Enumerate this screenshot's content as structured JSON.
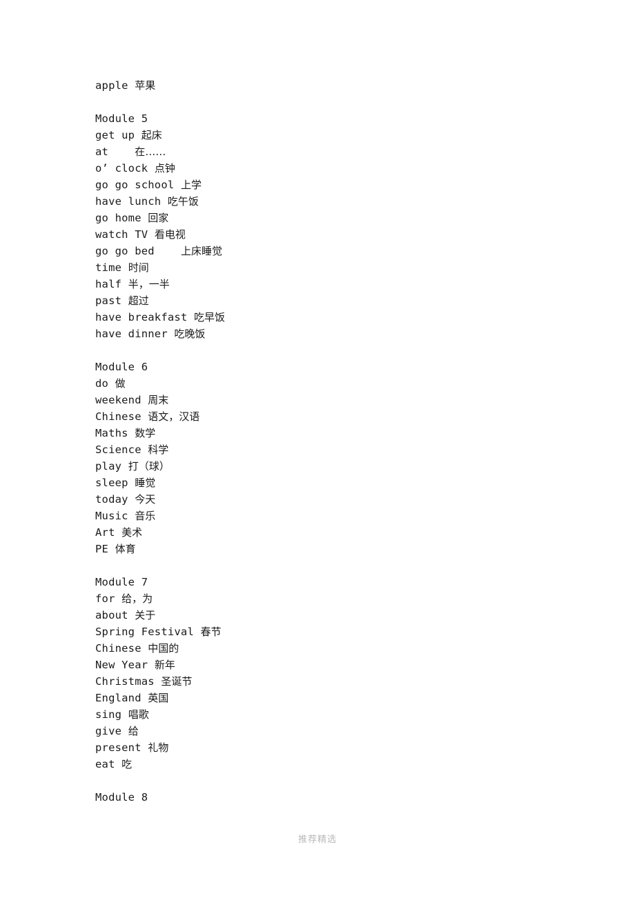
{
  "document": {
    "background_color": "#ffffff",
    "text_color": "#1b1b1b",
    "footer_color": "#b9b9b9",
    "blocks": [
      {
        "id": "block-intro",
        "lines": [
          {
            "en": "apple",
            "cn": "苹果",
            "sep": " "
          }
        ]
      },
      {
        "id": "block-module-5",
        "heading": "Module 5",
        "lines": [
          {
            "en": "get up",
            "cn": "起床",
            "sep": " "
          },
          {
            "en": "at",
            "cn": "在……",
            "sep": "    "
          },
          {
            "en": "o’ clock",
            "cn": "点钟",
            "sep": " "
          },
          {
            "en": "go go school",
            "cn": "上学",
            "sep": " "
          },
          {
            "en": "have lunch",
            "cn": "吃午饭",
            "sep": " "
          },
          {
            "en": "go home",
            "cn": "回家",
            "sep": " "
          },
          {
            "en": "watch TV",
            "cn": "看电视",
            "sep": " "
          },
          {
            "en": "go go bed",
            "cn": "上床睡觉",
            "sep": "    "
          },
          {
            "en": "time",
            "cn": "时间",
            "sep": " "
          },
          {
            "en": "half",
            "cn": "半，一半",
            "sep": " "
          },
          {
            "en": "past",
            "cn": "超过",
            "sep": " "
          },
          {
            "en": "have breakfast",
            "cn": "吃早饭",
            "sep": " "
          },
          {
            "en": "have dinner",
            "cn": "吃晚饭",
            "sep": " "
          }
        ]
      },
      {
        "id": "block-module-6",
        "heading": "Module 6",
        "lines": [
          {
            "en": "do",
            "cn": "做",
            "sep": " "
          },
          {
            "en": "weekend",
            "cn": "周末",
            "sep": " "
          },
          {
            "en": "Chinese",
            "cn": "语文，汉语",
            "sep": " "
          },
          {
            "en": "Maths",
            "cn": "数学",
            "sep": " "
          },
          {
            "en": "Science",
            "cn": "科学",
            "sep": " "
          },
          {
            "en": "play",
            "cn": "打（球）",
            "sep": " "
          },
          {
            "en": "sleep",
            "cn": "睡觉",
            "sep": " "
          },
          {
            "en": "today",
            "cn": "今天",
            "sep": " "
          },
          {
            "en": "Music",
            "cn": "音乐",
            "sep": " "
          },
          {
            "en": "Art",
            "cn": "美术",
            "sep": " "
          },
          {
            "en": "PE",
            "cn": "体育",
            "sep": " "
          }
        ]
      },
      {
        "id": "block-module-7",
        "heading": "Module 7",
        "lines": [
          {
            "en": "for",
            "cn": "给，为",
            "sep": " "
          },
          {
            "en": "about",
            "cn": "关于",
            "sep": " "
          },
          {
            "en": "Spring Festival",
            "cn": "春节",
            "sep": " "
          },
          {
            "en": "Chinese",
            "cn": "中国的",
            "sep": " "
          },
          {
            "en": "New Year",
            "cn": "新年",
            "sep": " "
          },
          {
            "en": "Christmas",
            "cn": "圣诞节",
            "sep": " "
          },
          {
            "en": "England",
            "cn": "英国",
            "sep": " "
          },
          {
            "en": "sing",
            "cn": "唱歌",
            "sep": " "
          },
          {
            "en": "give",
            "cn": "给",
            "sep": " "
          },
          {
            "en": "present",
            "cn": "礼物",
            "sep": " "
          },
          {
            "en": "eat",
            "cn": "吃",
            "sep": " "
          }
        ]
      },
      {
        "id": "block-module-8",
        "heading": "Module 8",
        "lines": []
      }
    ]
  },
  "footer": {
    "watermark": "推荐精选"
  }
}
